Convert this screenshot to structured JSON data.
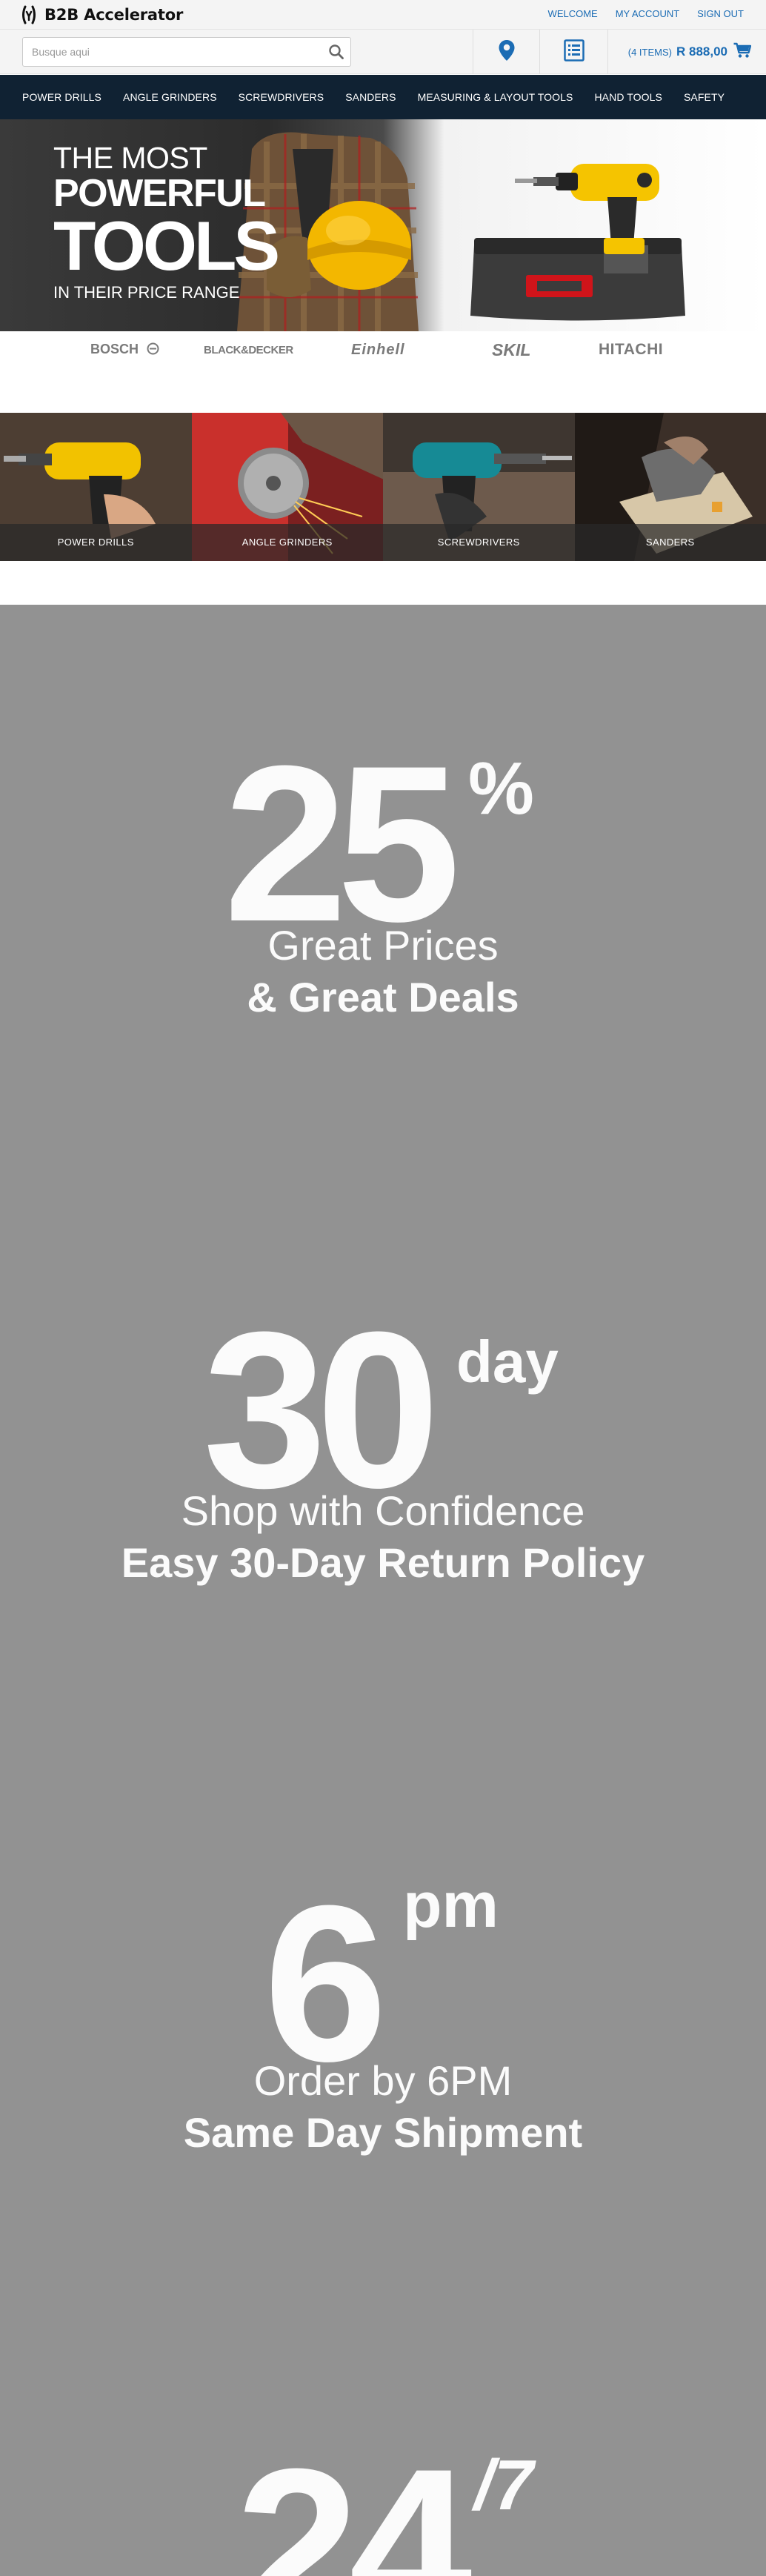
{
  "brand": {
    "name": "B2B Accelerator"
  },
  "toplinks": {
    "welcome": "WELCOME",
    "account": "MY ACCOUNT",
    "signout": "SIGN OUT"
  },
  "search": {
    "placeholder": "Busque aqui"
  },
  "cart": {
    "count": "(4 ITEMS)",
    "total": "R 888,00"
  },
  "nav": [
    {
      "label": "POWER DRILLS"
    },
    {
      "label": "ANGLE GRINDERS"
    },
    {
      "label": "SCREWDRIVERS"
    },
    {
      "label": "SANDERS"
    },
    {
      "label": "MEASURING & LAYOUT TOOLS"
    },
    {
      "label": "HAND TOOLS"
    },
    {
      "label": "SAFETY"
    }
  ],
  "hero": {
    "line1": "THE MOST",
    "line2": "POWERFUL",
    "line3": "TOOLS",
    "line4": "IN THEIR PRICE RANGE"
  },
  "brands": [
    "BOSCH",
    "BLACK&DECKER",
    "Einhell",
    "SKIL",
    "HITACHI"
  ],
  "categories": [
    {
      "label": "POWER DRILLS"
    },
    {
      "label": "ANGLE GRINDERS"
    },
    {
      "label": "SCREWDRIVERS"
    },
    {
      "label": "SANDERS"
    }
  ],
  "promos": [
    {
      "number": "25",
      "suffix": "%",
      "line1": "Great Prices",
      "line2": "& Great Deals"
    },
    {
      "number": "30",
      "suffix": "day",
      "line1": "Shop with Confidence",
      "line2": "Easy 30-Day Return Policy"
    },
    {
      "number": "6",
      "suffix": "pm",
      "line1": "Order by 6PM",
      "line2": "Same Day Shipment"
    },
    {
      "number": "24",
      "suffix": "/7"
    }
  ],
  "colors": {
    "nav_bg": "#102233",
    "link": "#1b6cb4",
    "promo_bg": "#929292"
  }
}
